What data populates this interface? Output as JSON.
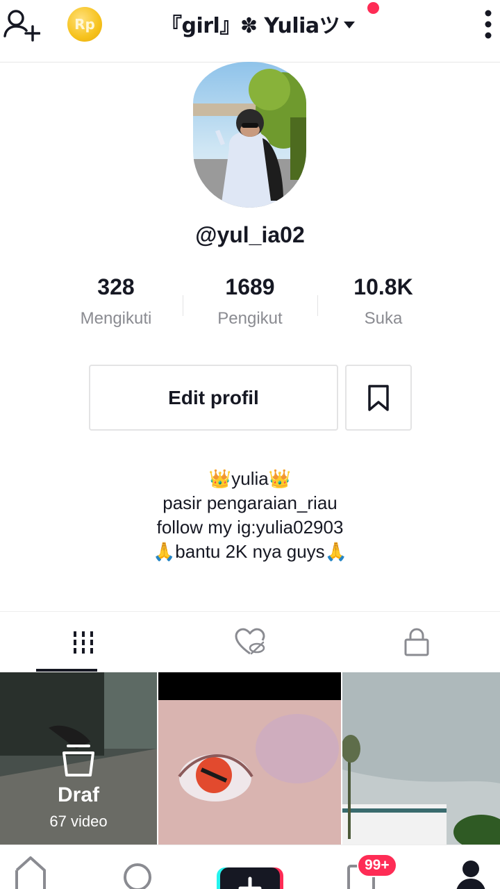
{
  "header": {
    "title": "『girl』✽ Yuliaツ",
    "coin_label": "Rp"
  },
  "profile": {
    "username": "@yul_ia02",
    "stats": [
      {
        "value": "328",
        "label": "Mengikuti"
      },
      {
        "value": "1689",
        "label": "Pengikut"
      },
      {
        "value": "10.8K",
        "label": "Suka"
      }
    ],
    "edit_label": "Edit profil",
    "bio": [
      "👑yulia👑",
      "pasir pengaraian_riau",
      "follow my ig:yulia02903",
      "🙏bantu 2K nya guys🙏"
    ]
  },
  "tabs": [
    "videos-grid-icon",
    "liked-hidden-icon",
    "private-lock-icon"
  ],
  "grid": {
    "draft_label": "Draf",
    "draft_count": "67 video"
  },
  "nav": {
    "inbox_badge": "99+"
  },
  "colors": {
    "accent": "#fe2c55",
    "text": "#161823",
    "muted": "#8a8b91",
    "border": "#e3e3e4"
  }
}
